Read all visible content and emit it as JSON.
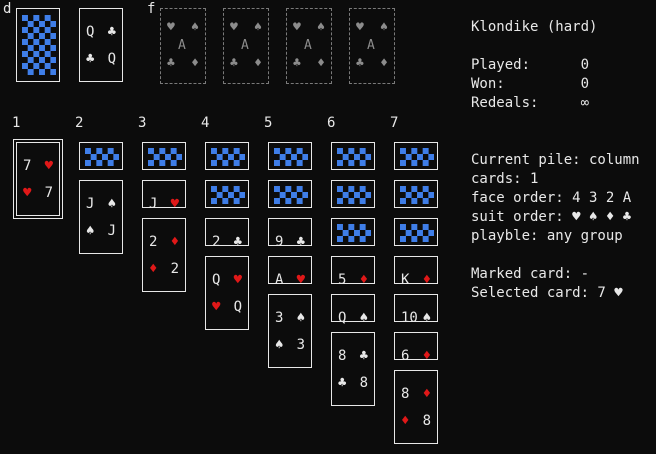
{
  "labels": {
    "deck": "d",
    "foundation": "f",
    "columns": [
      "1",
      "2",
      "3",
      "4",
      "5",
      "6",
      "7"
    ]
  },
  "colors": {
    "background": "#0c0c0c",
    "text": "#e8e8e8",
    "red_suit": "#e01818",
    "card_back": "#3f7ee8",
    "empty_slot": "#7a7a7a"
  },
  "icons": {
    "card_back": "blue-checker-pattern",
    "empty_foundation": "ace-placeholder"
  },
  "stock": {
    "state": "face-down"
  },
  "waste": {
    "rank": "Q",
    "suit": "♣",
    "color": "black"
  },
  "foundations": [
    {
      "rank": "A",
      "suits": [
        "♥",
        "♠",
        "♣",
        "♦"
      ]
    },
    {
      "rank": "A",
      "suits": [
        "♥",
        "♠",
        "♣",
        "♦"
      ]
    },
    {
      "rank": "A",
      "suits": [
        "♥",
        "♠",
        "♣",
        "♦"
      ]
    },
    {
      "rank": "A",
      "suits": [
        "♥",
        "♠",
        "♣",
        "♦"
      ]
    }
  ],
  "tableau": [
    {
      "hidden": 0,
      "cards": [
        {
          "rank": "7",
          "suit": "♥",
          "color": "red",
          "selected": true
        }
      ]
    },
    {
      "hidden": 1,
      "cards": [
        {
          "rank": "J",
          "suit": "♠",
          "color": "black"
        }
      ]
    },
    {
      "hidden": 1,
      "cards": [
        {
          "rank": "J",
          "suit": "♥",
          "color": "red"
        },
        {
          "rank": "2",
          "suit": "♦",
          "color": "red"
        }
      ]
    },
    {
      "hidden": 2,
      "cards": [
        {
          "rank": "2",
          "suit": "♣",
          "color": "black"
        },
        {
          "rank": "Q",
          "suit": "♥",
          "color": "red"
        }
      ]
    },
    {
      "hidden": 2,
      "cards": [
        {
          "rank": "9",
          "suit": "♣",
          "color": "black"
        },
        {
          "rank": "A",
          "suit": "♥",
          "color": "red"
        },
        {
          "rank": "3",
          "suit": "♠",
          "color": "black"
        }
      ]
    },
    {
      "hidden": 3,
      "cards": [
        {
          "rank": "5",
          "suit": "♦",
          "color": "red"
        },
        {
          "rank": "Q",
          "suit": "♠",
          "color": "black"
        },
        {
          "rank": "8",
          "suit": "♣",
          "color": "black"
        }
      ]
    },
    {
      "hidden": 3,
      "cards": [
        {
          "rank": "K",
          "suit": "♦",
          "color": "red"
        },
        {
          "rank": "10",
          "suit": "♠",
          "color": "black"
        },
        {
          "rank": "6",
          "suit": "♦",
          "color": "red"
        },
        {
          "rank": "8",
          "suit": "♦",
          "color": "red"
        }
      ]
    }
  ],
  "info": {
    "title": "Klondike (hard)",
    "played": "Played:      0",
    "won": "Won:         0",
    "redeals": "Redeals:     ∞",
    "current_pile": "Current pile: column",
    "cards": "cards: 1",
    "face_order": "face order: 4 3 2 A",
    "suit_order": "suit order: ♥ ♠ ♦ ♣",
    "playable": "playble: any group",
    "marked_card": "Marked card: -",
    "selected_card": "Selected card: 7 ♥"
  }
}
